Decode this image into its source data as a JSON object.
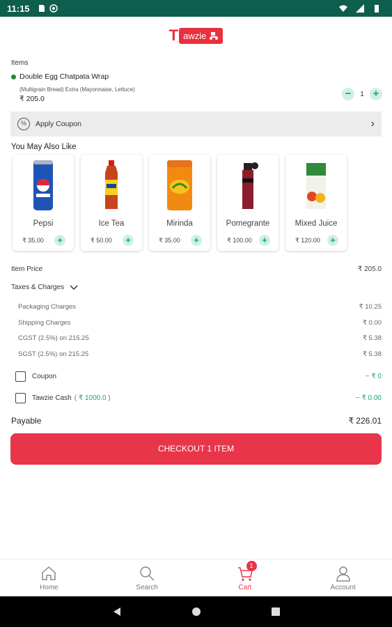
{
  "status_bar": {
    "time": "11:15"
  },
  "header": {
    "logo_letter": "T",
    "logo_text": "awzie"
  },
  "cart": {
    "items_label": "Items",
    "item": {
      "name": "Double Egg Chatpata Wrap",
      "description": "(Multigrain Bread) Extra (Mayonnaise, Lettuce)",
      "price": "₹ 205.0",
      "quantity": "1"
    },
    "coupon_label": "Apply Coupon",
    "you_may_also_like": "You May Also Like",
    "products": [
      {
        "name": "Pepsi",
        "price": "₹ 35.00"
      },
      {
        "name": "Ice Tea",
        "price": "₹ 50.00"
      },
      {
        "name": "Mirinda",
        "price": "₹ 35.00"
      },
      {
        "name": "Pomegrante",
        "price": "₹ 100.00"
      },
      {
        "name": "Mixed Juice",
        "price": "₹ 120.00"
      }
    ],
    "bill": {
      "item_price_label": "Item Price",
      "item_price": "₹ 205.0",
      "taxes_label": "Taxes & Charges",
      "charges": [
        {
          "label": "Packaging Charges",
          "value": "₹ 10.25"
        },
        {
          "label": "Shipping Charges",
          "value": "₹ 0.00"
        },
        {
          "label": "CGST (2.5%) on 215.25",
          "value": "₹ 5.38"
        },
        {
          "label": "SGST (2.5%) on 215.25",
          "value": "₹ 5.38"
        }
      ],
      "coupon_label": "Coupon",
      "coupon_value": "− ₹ 0",
      "tawzie_cash_label": "Tawzie Cash",
      "tawzie_cash_balance": "( ₹ 1000.0 )",
      "tawzie_cash_value": "− ₹ 0.00",
      "payable_label": "Payable",
      "payable_value": "₹ 226.01"
    },
    "checkout_label": "CHECKOUT 1 ITEM"
  },
  "bottom_nav": [
    {
      "label": "Home",
      "icon": "home-icon"
    },
    {
      "label": "Search",
      "icon": "search-icon"
    },
    {
      "label": "Cart",
      "icon": "cart-icon",
      "badge": "1",
      "active": true
    },
    {
      "label": "Account",
      "icon": "account-icon"
    }
  ],
  "colors": {
    "accent": "#e8354a",
    "status_bar": "#0d5e4c",
    "green": "#1aa37a"
  }
}
